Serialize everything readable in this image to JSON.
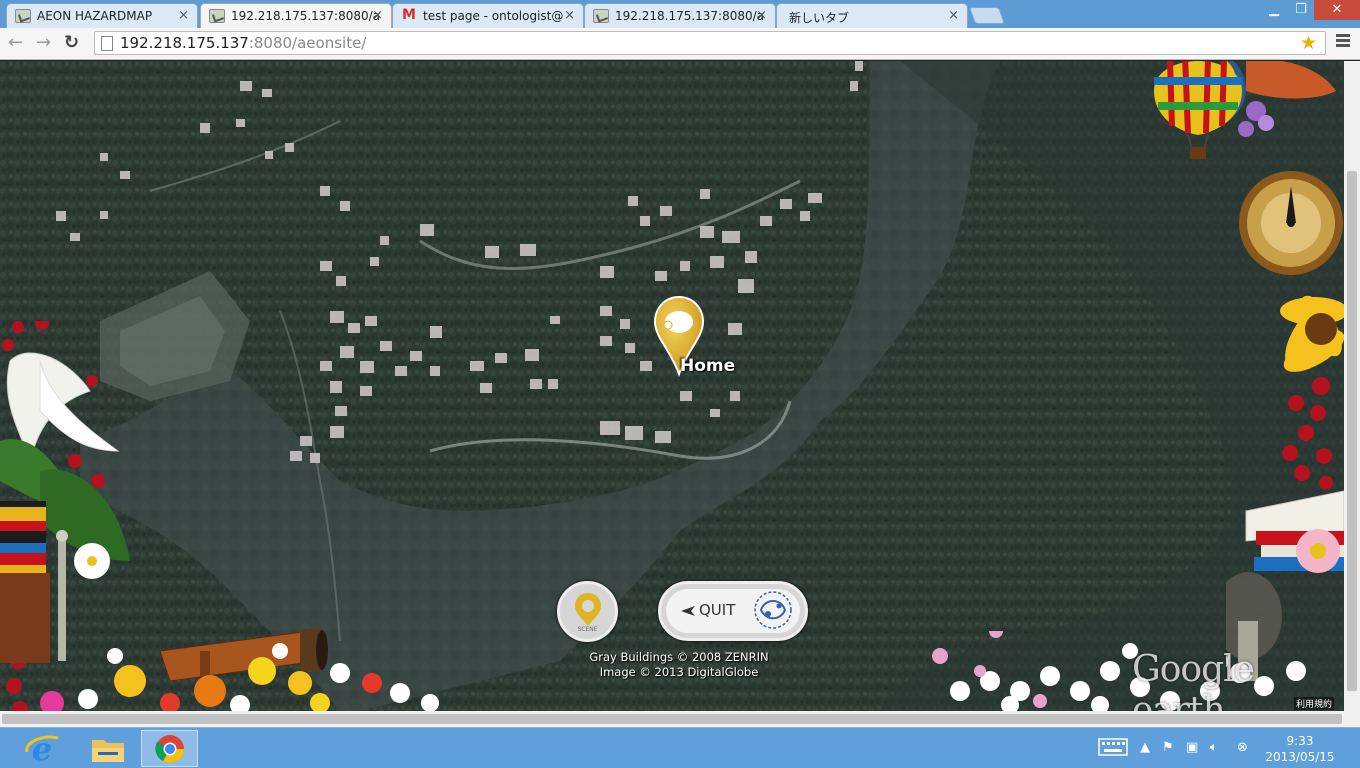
{
  "browser": {
    "tabs": [
      {
        "title": "AEON HAZARDMAP",
        "active": false
      },
      {
        "title": "192.218.175.137:8080/a",
        "active": true
      },
      {
        "title": "test page - ontologist@",
        "active": false
      },
      {
        "title": "192.218.175.137:8080/a",
        "active": false
      },
      {
        "title": "新しいタブ",
        "active": false
      }
    ],
    "close_glyph": "×",
    "url_host": "192.218.175.137",
    "url_rest": ":8080/aeonsite/"
  },
  "map": {
    "placemark_label": "Home",
    "scene_button_label": "SCENE",
    "quit_button_label": "QUIT",
    "credits": [
      "Gray Buildings © 2008 ZENRIN",
      "Image © 2013 DigitalGlobe"
    ],
    "google_earth_logo": "Google earth",
    "terms_link": "利用規約"
  },
  "taskbar": {
    "time": "9:33",
    "date": "2013/05/15",
    "pinned": [
      "internet-explorer-icon",
      "file-explorer-icon",
      "chrome-icon"
    ],
    "tray_icons": [
      "keyboard-icon",
      "show-hidden-icons-arrow",
      "action-center-flag-icon",
      "network-icon",
      "volume-icon",
      "close-circle-icon"
    ]
  },
  "colors": {
    "taskbar": "#5e9fdc",
    "tabbar": "#5d9bd5",
    "placemark": "#e0b325",
    "terrain": "#2f3d38",
    "water": "#3a4542"
  }
}
